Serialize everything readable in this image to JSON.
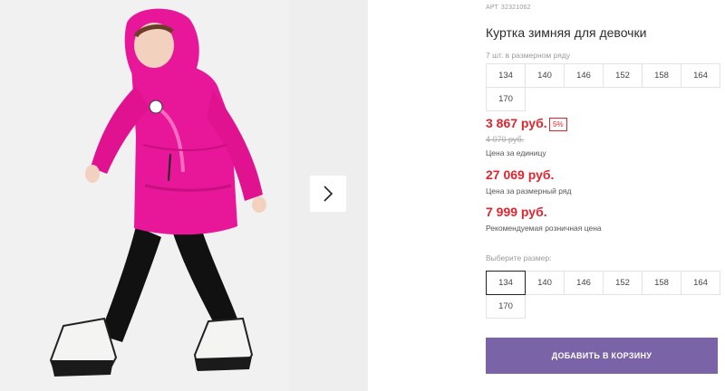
{
  "product": {
    "article_label": "АРТ",
    "article_number": "32321062",
    "title": "Куртка зимняя для девочки",
    "row_label": "7 шт. в размерном ряду",
    "row_sizes": [
      "134",
      "140",
      "146",
      "152",
      "158",
      "164",
      "170"
    ]
  },
  "pricing": {
    "price": "3 867 руб.",
    "discount": "5%",
    "old_price": "4 070 руб.",
    "price_caption": "Цена за единицу",
    "row_price": "27 069 руб.",
    "row_price_caption": "Цена за размерный ряд",
    "rrp": "7 999 руб.",
    "rrp_caption": "Рекомендуемая розничная цена"
  },
  "size_picker": {
    "label": "Выберите размер:",
    "selected": "134",
    "sizes": [
      "134",
      "140",
      "146",
      "152",
      "158",
      "164",
      "170"
    ]
  },
  "cart": {
    "button_label": "ДОБАВИТЬ В КОРЗИНУ"
  },
  "colors": {
    "price_red": "#e2242e",
    "button_purple": "#7a63a6",
    "jacket_pink": "#e8179a"
  },
  "icons": {
    "next": "chevron-right-icon"
  }
}
